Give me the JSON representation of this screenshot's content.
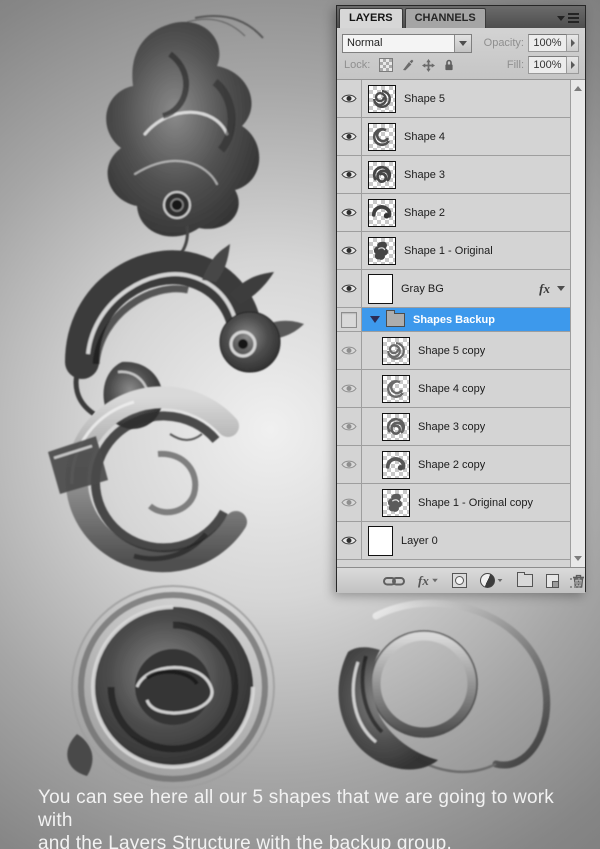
{
  "panel": {
    "tabs": [
      {
        "label": "LAYERS",
        "active": true
      },
      {
        "label": "CHANNELS",
        "active": false
      }
    ],
    "blend_mode": {
      "value": "Normal"
    },
    "opacity": {
      "label": "Opacity:",
      "value": "100%"
    },
    "lock": {
      "label": "Lock:"
    },
    "fill": {
      "label": "Fill:",
      "value": "100%"
    },
    "layers": [
      {
        "name": "Shape 5",
        "type": "layer",
        "eye": "on",
        "thumb": "checker-swirl"
      },
      {
        "name": "Shape 4",
        "type": "layer",
        "eye": "on",
        "thumb": "checker-swirl"
      },
      {
        "name": "Shape 3",
        "type": "layer",
        "eye": "on",
        "thumb": "checker-swirl"
      },
      {
        "name": "Shape 2",
        "type": "layer",
        "eye": "on",
        "thumb": "checker-swirl"
      },
      {
        "name": "Shape 1 - Original",
        "type": "layer",
        "eye": "on",
        "thumb": "checker-swirl"
      },
      {
        "name": "Gray BG",
        "type": "layer",
        "eye": "on",
        "thumb": "white",
        "has_fx": true
      },
      {
        "name": "Shapes Backup",
        "type": "group",
        "eye": "off",
        "selected": true,
        "expanded": true
      },
      {
        "name": "Shape 5 copy",
        "type": "layer",
        "eye": "dim",
        "thumb": "checker-swirl",
        "in_group": true
      },
      {
        "name": "Shape 4 copy",
        "type": "layer",
        "eye": "dim",
        "thumb": "checker-swirl",
        "in_group": true
      },
      {
        "name": "Shape 3 copy",
        "type": "layer",
        "eye": "dim",
        "thumb": "checker-swirl",
        "in_group": true
      },
      {
        "name": "Shape 2 copy",
        "type": "layer",
        "eye": "dim",
        "thumb": "checker-swirl",
        "in_group": true
      },
      {
        "name": "Shape 1 - Original copy",
        "type": "layer",
        "eye": "dim",
        "thumb": "checker-swirl",
        "in_group": true
      },
      {
        "name": "Layer 0",
        "type": "layer",
        "eye": "on",
        "thumb": "white"
      }
    ],
    "fx_badge": "fx",
    "toolbar_icons": [
      "link-layers",
      "layer-style-fx",
      "add-layer-mask",
      "adjustment-layer",
      "new-group",
      "new-layer",
      "delete-layer"
    ],
    "scrollbar": {
      "up_arrow": true,
      "down_arrow": true
    }
  },
  "caption": {
    "line1": "You can see here all our 5 shapes that we are going to work with",
    "line2": "and the Layers Structure with the backup group."
  },
  "colors": {
    "selection_blue": "#3d99ec",
    "panel_background": "#d4d4d4",
    "tabstrip_dark": "#565656",
    "canvas_gray_edge": "#7f7f7f",
    "canvas_gray_center": "#efefef",
    "caption_text": "#f2f2f2"
  }
}
